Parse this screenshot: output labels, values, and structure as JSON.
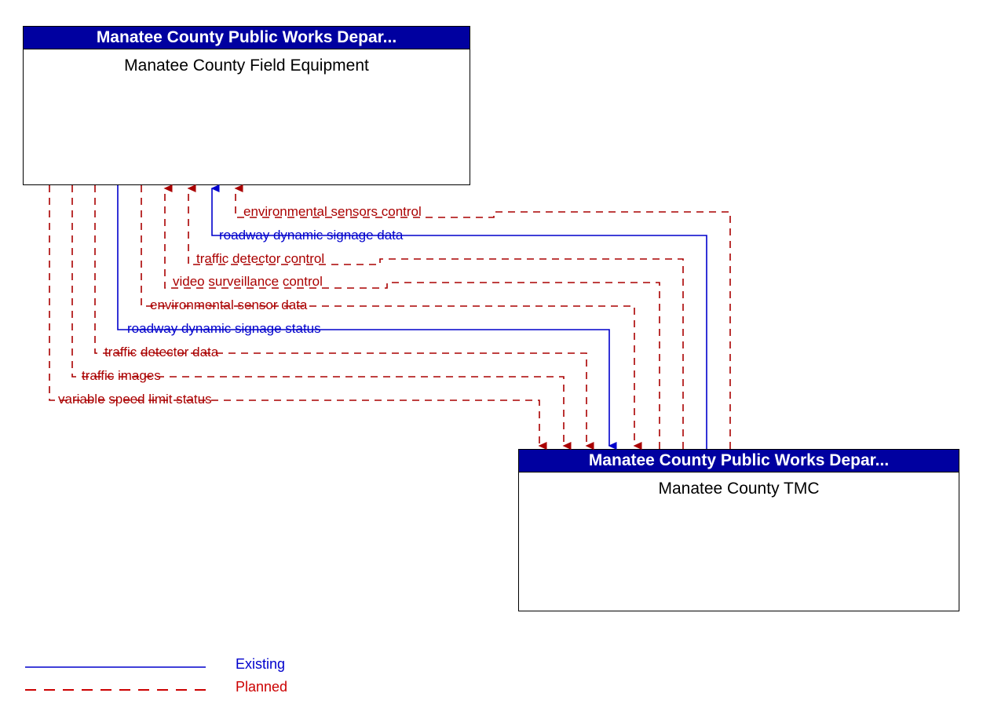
{
  "diagram": {
    "title": "Manatee County Field Equipment to Manatee County TMC interface flows",
    "colors": {
      "existing": "#0000CC",
      "planned": "#AA0000",
      "header_fill": "#0000A0",
      "header_text": "#FFFFFF",
      "box_border": "#000000",
      "box_fill": "#FFFFFF"
    }
  },
  "boxes": [
    {
      "id": "field-equipment",
      "stakeholder": "Manatee County Public Works Depar...",
      "name": "Manatee County Field Equipment"
    },
    {
      "id": "tmc",
      "stakeholder": "Manatee County Public Works Depar...",
      "name": "Manatee County TMC"
    }
  ],
  "flows": [
    {
      "label": "environmental sensors control",
      "status": "Planned",
      "direction": "tmc-to-field"
    },
    {
      "label": "roadway dynamic signage data",
      "status": "Existing",
      "direction": "tmc-to-field"
    },
    {
      "label": "traffic detector control",
      "status": "Planned",
      "direction": "tmc-to-field"
    },
    {
      "label": "video surveillance control",
      "status": "Planned",
      "direction": "tmc-to-field"
    },
    {
      "label": "environmental sensor data",
      "status": "Planned",
      "direction": "field-to-tmc"
    },
    {
      "label": "roadway dynamic signage status",
      "status": "Existing",
      "direction": "field-to-tmc"
    },
    {
      "label": "traffic detector data",
      "status": "Planned",
      "direction": "field-to-tmc"
    },
    {
      "label": "traffic images",
      "status": "Planned",
      "direction": "field-to-tmc"
    },
    {
      "label": "variable speed limit status",
      "status": "Planned",
      "direction": "field-to-tmc"
    }
  ],
  "legend": {
    "existing_label": "Existing",
    "planned_label": "Planned"
  }
}
